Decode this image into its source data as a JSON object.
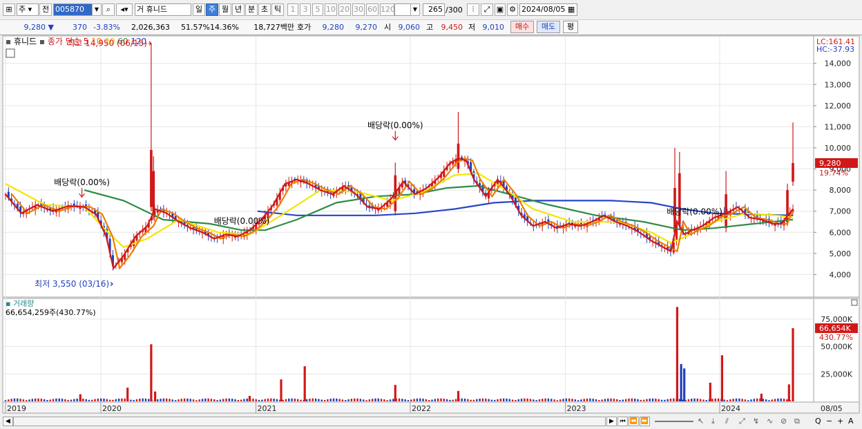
{
  "toolbar": {
    "market": "주",
    "prev_label": "전",
    "code": "005870",
    "search_icon": "magnifier-icon",
    "speaker_icon": "speaker-icon",
    "name": "거 휴니드",
    "periods": [
      "일",
      "주",
      "월",
      "년",
      "분",
      "초",
      "틱"
    ],
    "selected_period": "주",
    "intervals": [
      "1",
      "3",
      "5",
      "10",
      "20",
      "30",
      "60",
      "120"
    ],
    "count": "265",
    "count_max": "/300",
    "date": "2024/08/05"
  },
  "quote": {
    "price": "9,280",
    "change_arrow": "▼",
    "change": "370",
    "change_pct": "-3.83%",
    "volume": "2,026,363",
    "vol_ratio": "51.57%",
    "turnover": "14.36%",
    "amount": "18,727백만",
    "ask_label": "호가",
    "ask": "9,280",
    "bid": "9,270",
    "open_label": "시",
    "open": "9,060",
    "high_label": "고",
    "high": "9,450",
    "low_label": "저",
    "low": "9,010",
    "buy_button": "매수",
    "sell_button": "매도",
    "eval_button": "평"
  },
  "colors": {
    "up": "#d01818",
    "down": "#1f3fbf",
    "ma5": "#d01818",
    "ma10": "#ee7d00",
    "ma20": "#f2e600",
    "ma60": "#2e8b46",
    "ma120": "#2646c8"
  },
  "chart_data": {
    "type": "candlestick",
    "stock": "휴니드",
    "legend_prefix": "종가 단순",
    "ma_periods": [
      "5",
      "10",
      "20",
      "60",
      "120"
    ],
    "right_top": [
      "LC:161.41",
      "HC:-37.93"
    ],
    "y_ticks": [
      "14,000",
      "13,000",
      "12,000",
      "11,000",
      "10,000",
      "9,000",
      "8,000",
      "7,000",
      "6,000",
      "5,000",
      "4,000"
    ],
    "ylim": [
      3000,
      15200
    ],
    "x_ticks": [
      {
        "label": "2019",
        "t": 0
      },
      {
        "label": "2020",
        "t": 0.121
      },
      {
        "label": "2021",
        "t": 0.318
      },
      {
        "label": "2022",
        "t": 0.514
      },
      {
        "label": "2023",
        "t": 0.711
      },
      {
        "label": "2024",
        "t": 0.907
      }
    ],
    "last_date_label": "08/05",
    "current_price_label": "9,280",
    "current_price": 9280,
    "current_pct_label": "19.74%",
    "annotations": [
      {
        "text": "최고 14,950 (06/15)",
        "t": 0.185,
        "price": 14950,
        "kind": "high"
      },
      {
        "text": "최저 3,550 (03/16)",
        "t": 0.137,
        "price": 3550,
        "kind": "low"
      },
      {
        "text": "배당락(0.00%)",
        "t": 0.097,
        "price": 7900,
        "kind": "div"
      },
      {
        "text": "배당락(0.00%)",
        "t": 0.495,
        "price": 10600,
        "kind": "div"
      },
      {
        "text": "배당락(0.00%)",
        "t": 0.3,
        "price": 6400,
        "kind": "divtext"
      },
      {
        "text": "배당락(0.00%)",
        "t": 0.875,
        "price": 6850,
        "kind": "divtext"
      }
    ],
    "close_series": [
      [
        0,
        7800
      ],
      [
        0.02,
        6900
      ],
      [
        0.04,
        7300
      ],
      [
        0.06,
        7000
      ],
      [
        0.08,
        7250
      ],
      [
        0.1,
        7200
      ],
      [
        0.115,
        6850
      ],
      [
        0.128,
        5800
      ],
      [
        0.137,
        4300
      ],
      [
        0.15,
        4900
      ],
      [
        0.165,
        5800
      ],
      [
        0.18,
        6300
      ],
      [
        0.19,
        7100
      ],
      [
        0.205,
        6900
      ],
      [
        0.22,
        6500
      ],
      [
        0.235,
        6200
      ],
      [
        0.25,
        6000
      ],
      [
        0.265,
        5700
      ],
      [
        0.28,
        5900
      ],
      [
        0.295,
        5800
      ],
      [
        0.31,
        6100
      ],
      [
        0.325,
        6600
      ],
      [
        0.34,
        7300
      ],
      [
        0.355,
        8300
      ],
      [
        0.37,
        8500
      ],
      [
        0.385,
        8300
      ],
      [
        0.4,
        8000
      ],
      [
        0.415,
        7800
      ],
      [
        0.43,
        8200
      ],
      [
        0.445,
        7800
      ],
      [
        0.46,
        7200
      ],
      [
        0.475,
        7100
      ],
      [
        0.49,
        7600
      ],
      [
        0.505,
        8400
      ],
      [
        0.52,
        7800
      ],
      [
        0.535,
        8100
      ],
      [
        0.55,
        8600
      ],
      [
        0.565,
        9300
      ],
      [
        0.575,
        9500
      ],
      [
        0.585,
        9400
      ],
      [
        0.595,
        8500
      ],
      [
        0.61,
        7700
      ],
      [
        0.625,
        8500
      ],
      [
        0.64,
        7800
      ],
      [
        0.655,
        6800
      ],
      [
        0.67,
        6300
      ],
      [
        0.685,
        6500
      ],
      [
        0.7,
        6200
      ],
      [
        0.715,
        6400
      ],
      [
        0.73,
        6300
      ],
      [
        0.745,
        6500
      ],
      [
        0.76,
        6800
      ],
      [
        0.775,
        6500
      ],
      [
        0.79,
        6300
      ],
      [
        0.805,
        6000
      ],
      [
        0.82,
        5600
      ],
      [
        0.835,
        5300
      ],
      [
        0.845,
        5100
      ],
      [
        0.853,
        6500
      ],
      [
        0.862,
        5900
      ],
      [
        0.872,
        6100
      ],
      [
        0.885,
        6300
      ],
      [
        0.9,
        6700
      ],
      [
        0.915,
        6900
      ],
      [
        0.93,
        7200
      ],
      [
        0.945,
        6700
      ],
      [
        0.96,
        6600
      ],
      [
        0.975,
        6400
      ],
      [
        0.985,
        6400
      ],
      [
        1.0,
        7100
      ]
    ],
    "ma20_series": [
      [
        0,
        8300
      ],
      [
        0.05,
        7300
      ],
      [
        0.1,
        7200
      ],
      [
        0.13,
        6000
      ],
      [
        0.15,
        5300
      ],
      [
        0.18,
        5700
      ],
      [
        0.22,
        6600
      ],
      [
        0.27,
        6000
      ],
      [
        0.31,
        5900
      ],
      [
        0.35,
        6800
      ],
      [
        0.4,
        8000
      ],
      [
        0.45,
        7900
      ],
      [
        0.49,
        7500
      ],
      [
        0.53,
        7900
      ],
      [
        0.57,
        8700
      ],
      [
        0.6,
        8800
      ],
      [
        0.64,
        7900
      ],
      [
        0.67,
        7100
      ],
      [
        0.72,
        6500
      ],
      [
        0.78,
        6500
      ],
      [
        0.82,
        6000
      ],
      [
        0.845,
        5500
      ],
      [
        0.87,
        5900
      ],
      [
        0.9,
        6500
      ],
      [
        0.94,
        6900
      ],
      [
        0.98,
        6800
      ],
      [
        1.0,
        6700
      ]
    ],
    "ma60_series": [
      [
        0.1,
        8000
      ],
      [
        0.15,
        7500
      ],
      [
        0.2,
        6600
      ],
      [
        0.26,
        6400
      ],
      [
        0.3,
        6100
      ],
      [
        0.33,
        6100
      ],
      [
        0.37,
        6600
      ],
      [
        0.42,
        7400
      ],
      [
        0.47,
        7700
      ],
      [
        0.52,
        7800
      ],
      [
        0.56,
        8100
      ],
      [
        0.6,
        8200
      ],
      [
        0.64,
        7800
      ],
      [
        0.69,
        7300
      ],
      [
        0.75,
        6800
      ],
      [
        0.81,
        6500
      ],
      [
        0.86,
        6100
      ],
      [
        0.9,
        6200
      ],
      [
        0.95,
        6400
      ],
      [
        1.0,
        6600
      ]
    ],
    "ma120_series": [
      [
        0.32,
        7000
      ],
      [
        0.37,
        6800
      ],
      [
        0.42,
        6800
      ],
      [
        0.47,
        6800
      ],
      [
        0.52,
        6900
      ],
      [
        0.57,
        7100
      ],
      [
        0.62,
        7400
      ],
      [
        0.67,
        7500
      ],
      [
        0.72,
        7500
      ],
      [
        0.77,
        7500
      ],
      [
        0.82,
        7400
      ],
      [
        0.86,
        7100
      ],
      [
        0.9,
        6900
      ],
      [
        0.95,
        6850
      ],
      [
        1.0,
        6800
      ]
    ],
    "spikes": [
      {
        "t": 0.185,
        "high": 14950,
        "open": 7200,
        "close": 9900
      },
      {
        "t": 0.188,
        "high": 9600,
        "open": 6800,
        "close": 8900
      },
      {
        "t": 0.495,
        "high": 9300,
        "open": 7000,
        "close": 8700
      },
      {
        "t": 0.575,
        "high": 11700,
        "open": 9000,
        "close": 10200
      },
      {
        "t": 0.85,
        "high": 10000,
        "open": 6000,
        "close": 8100
      },
      {
        "t": 0.856,
        "high": 9800,
        "open": 6400,
        "close": 8800
      },
      {
        "t": 0.915,
        "high": 8900,
        "open": 6200,
        "close": 7800
      },
      {
        "t": 0.993,
        "high": 8300,
        "open": 6500,
        "close": 8000
      },
      {
        "t": 1.0,
        "high": 11200,
        "open": 8400,
        "close": 9280
      }
    ],
    "volume": {
      "title": "거래량",
      "value_label": "66,654,259주(430.77%)",
      "y_ticks": [
        "75,000K",
        "50,000K",
        "25,000K"
      ],
      "last_label": "66,654K",
      "last_pct": "430.77%",
      "ylim": [
        0,
        90000
      ],
      "base": 1800,
      "bars": [
        {
          "t": 0.095,
          "v": 6500
        },
        {
          "t": 0.155,
          "v": 12500
        },
        {
          "t": 0.185,
          "v": 52000
        },
        {
          "t": 0.19,
          "v": 9000
        },
        {
          "t": 0.35,
          "v": 20000
        },
        {
          "t": 0.38,
          "v": 32000
        },
        {
          "t": 0.31,
          "v": 5000
        },
        {
          "t": 0.495,
          "v": 15000
        },
        {
          "t": 0.575,
          "v": 9500
        },
        {
          "t": 0.853,
          "v": 86000
        },
        {
          "t": 0.858,
          "v": 34000
        },
        {
          "t": 0.862,
          "v": 30000
        },
        {
          "t": 0.895,
          "v": 17000
        },
        {
          "t": 0.91,
          "v": 42000
        },
        {
          "t": 0.96,
          "v": 7000
        },
        {
          "t": 0.995,
          "v": 15500
        },
        {
          "t": 1.0,
          "v": 66654
        }
      ]
    }
  },
  "scroll_tools": [
    "▶",
    "⏮",
    "⏪",
    "⏩"
  ],
  "zoom_tools": [
    "Q",
    "−",
    "+",
    "A"
  ]
}
